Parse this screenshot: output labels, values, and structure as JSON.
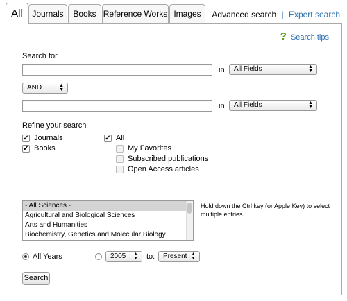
{
  "tabs": [
    {
      "label": "All",
      "active": true
    },
    {
      "label": "Journals",
      "active": false
    },
    {
      "label": "Books",
      "active": false
    },
    {
      "label": "Reference Works",
      "active": false
    },
    {
      "label": "Images",
      "active": false
    }
  ],
  "header_links": {
    "advanced": "Advanced search",
    "separator": "|",
    "expert": "Expert search"
  },
  "search_tips": "Search tips",
  "search_for": {
    "label": "Search for",
    "in_label": "in",
    "field1": {
      "value": "",
      "scope": "All Fields"
    },
    "operator": "AND",
    "field2": {
      "value": "",
      "scope": "All Fields"
    }
  },
  "refine": {
    "label": "Refine your search",
    "left": [
      {
        "label": "Journals",
        "checked": true
      },
      {
        "label": "Books",
        "checked": true
      }
    ],
    "right_all": {
      "label": "All",
      "checked": true
    },
    "right_sub": [
      {
        "label": "My Favorites",
        "checked": false
      },
      {
        "label": "Subscribed publications",
        "checked": false
      },
      {
        "label": "Open Access articles",
        "checked": false
      }
    ]
  },
  "subjects": {
    "options": [
      "- All Sciences -",
      "Agricultural and Biological Sciences",
      "Arts and Humanities",
      "Biochemistry, Genetics and Molecular Biology"
    ],
    "selected": "- All Sciences -",
    "hint": "Hold down the Ctrl key (or Apple Key) to select multiple entries."
  },
  "years": {
    "all_years_label": "All Years",
    "all_years_selected": true,
    "from_value": "2005",
    "to_label": "to:",
    "to_value": "Present"
  },
  "search_button": "Search"
}
